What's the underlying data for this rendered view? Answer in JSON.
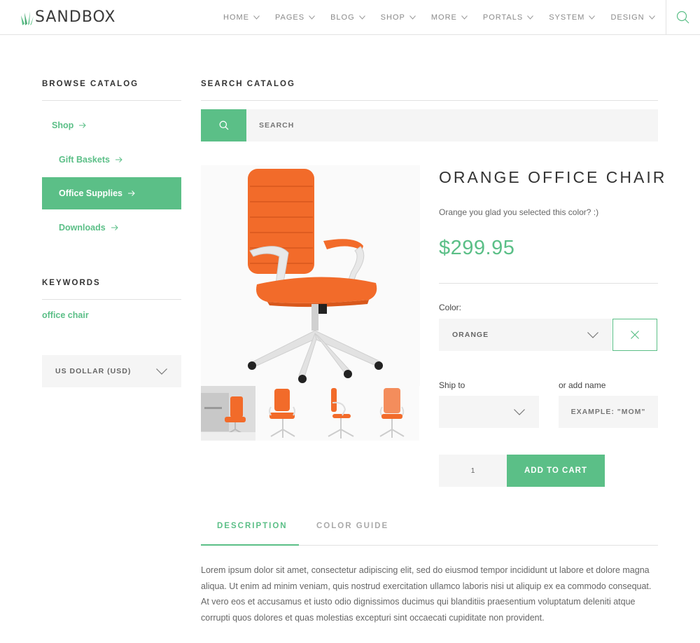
{
  "brand": {
    "name": "SANDBOX",
    "accent": "#5bbf87"
  },
  "nav": {
    "items": [
      {
        "label": "HOME"
      },
      {
        "label": "PAGES"
      },
      {
        "label": "BLOG"
      },
      {
        "label": "SHOP"
      },
      {
        "label": "MORE"
      },
      {
        "label": "PORTALS"
      },
      {
        "label": "SYSTEM"
      },
      {
        "label": "DESIGN"
      }
    ],
    "search_icon": "search-icon"
  },
  "sidebar": {
    "browse_title": "BROWSE CATALOG",
    "categories": [
      {
        "label": "Shop",
        "active": false
      },
      {
        "label": "Gift Baskets",
        "active": false
      },
      {
        "label": "Office Supplies",
        "active": true
      },
      {
        "label": "Downloads",
        "active": false
      }
    ],
    "keywords_title": "KEYWORDS",
    "keyword": "office chair",
    "currency": "US DOLLAR (USD)"
  },
  "search": {
    "title": "SEARCH CATALOG",
    "placeholder": "SEARCH"
  },
  "product": {
    "title": "ORANGE OFFICE CHAIR",
    "description": "Orange you glad you selected this color? :)",
    "price": "$299.95",
    "color_label": "Color:",
    "color_value": "ORANGE",
    "ship_label": "Ship to",
    "name_label": "or add name",
    "name_placeholder": "EXAMPLE: \"MOM\"",
    "quantity": "1",
    "add_to_cart": "ADD TO CART",
    "chair_color": "#f26b2a"
  },
  "tabs": {
    "items": [
      {
        "label": "DESCRIPTION",
        "active": true
      },
      {
        "label": "COLOR GUIDE",
        "active": false
      }
    ],
    "body": "Lorem ipsum dolor sit amet, consectetur adipiscing elit, sed do eiusmod tempor incididunt ut labore et dolore magna aliqua. Ut enim ad minim veniam, quis nostrud exercitation ullamco laboris nisi ut aliquip ex ea commodo consequat. At vero eos et accusamus et iusto odio dignissimos ducimus qui blanditiis praesentium voluptatum deleniti atque corrupti quos dolores et quas molestias excepturi sint occaecati cupiditate non provident."
  }
}
